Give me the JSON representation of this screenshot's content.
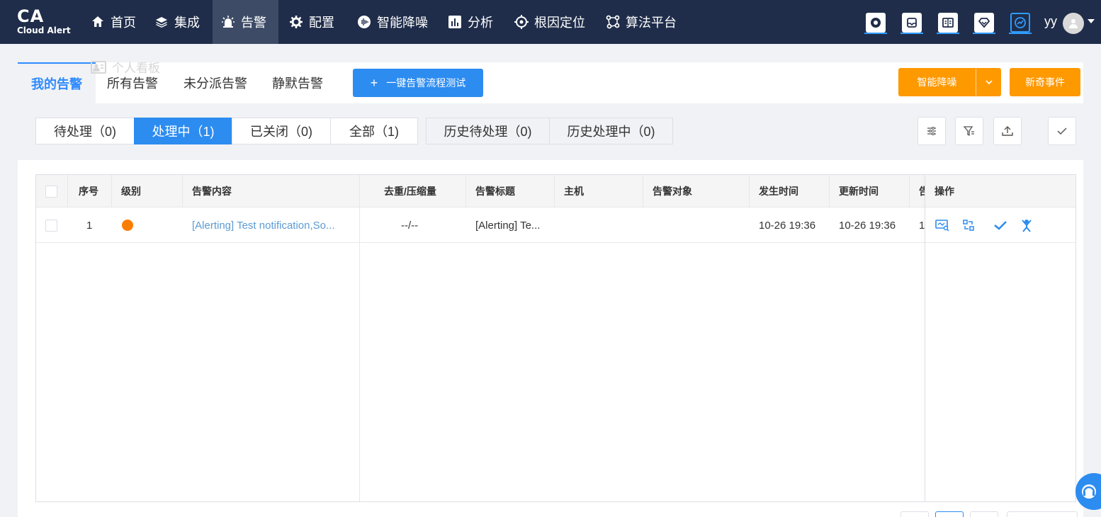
{
  "logo": {
    "title": "CA",
    "subtitle": "Cloud Alert"
  },
  "nav": {
    "items": [
      {
        "label": "首页",
        "icon": "home-icon"
      },
      {
        "label": "集成",
        "icon": "layers-icon"
      },
      {
        "label": "告警",
        "icon": "alarm-icon",
        "active": true
      },
      {
        "label": "配置",
        "icon": "gear-icon"
      },
      {
        "label": "智能降噪",
        "icon": "noise-icon"
      },
      {
        "label": "分析",
        "icon": "chart-icon"
      },
      {
        "label": "根因定位",
        "icon": "target-icon"
      },
      {
        "label": "算法平台",
        "icon": "algorithm-icon"
      }
    ],
    "tools": [
      "support-icon",
      "inbox-icon",
      "book-icon",
      "diamond-icon",
      "dashboard-icon"
    ],
    "user": "yy"
  },
  "ghost_label": "个人看板",
  "tabs": [
    {
      "label": "我的告警",
      "active": true
    },
    {
      "label": "所有告警"
    },
    {
      "label": "未分派告警"
    },
    {
      "label": "静默告警"
    }
  ],
  "actions": {
    "flow_test": "一键告警流程测试",
    "smart_denoise": "智能降噪",
    "new_event": "新奇事件"
  },
  "filters": [
    {
      "label": "待处理（0)"
    },
    {
      "label": "处理中（1)",
      "active": true
    },
    {
      "label": "已关闭（0)"
    },
    {
      "label": "全部（1)"
    },
    {
      "label": "历史待处理（0)"
    },
    {
      "label": "历史处理中（0)"
    }
  ],
  "table": {
    "columns": [
      "序号",
      "级别",
      "告警内容",
      "去重/压缩量",
      "告警标题",
      "主机",
      "告警对象",
      "发生时间",
      "更新时间",
      "告",
      "操作"
    ],
    "rows": [
      {
        "index": "1",
        "level_color": "#fa7d00",
        "content": "[Alerting] Test notification,So...",
        "dedup": "--/--",
        "title": "[Alerting] Te...",
        "host": "",
        "object": "",
        "occur_time": "10-26 19:36",
        "update_time": "10-26 19:36",
        "extra": "1("
      }
    ]
  },
  "colors": {
    "nav_bg": "#1f2d4a",
    "primary": "#2d8cf0",
    "orange": "#ff9900",
    "level_orange": "#fa7d00"
  }
}
